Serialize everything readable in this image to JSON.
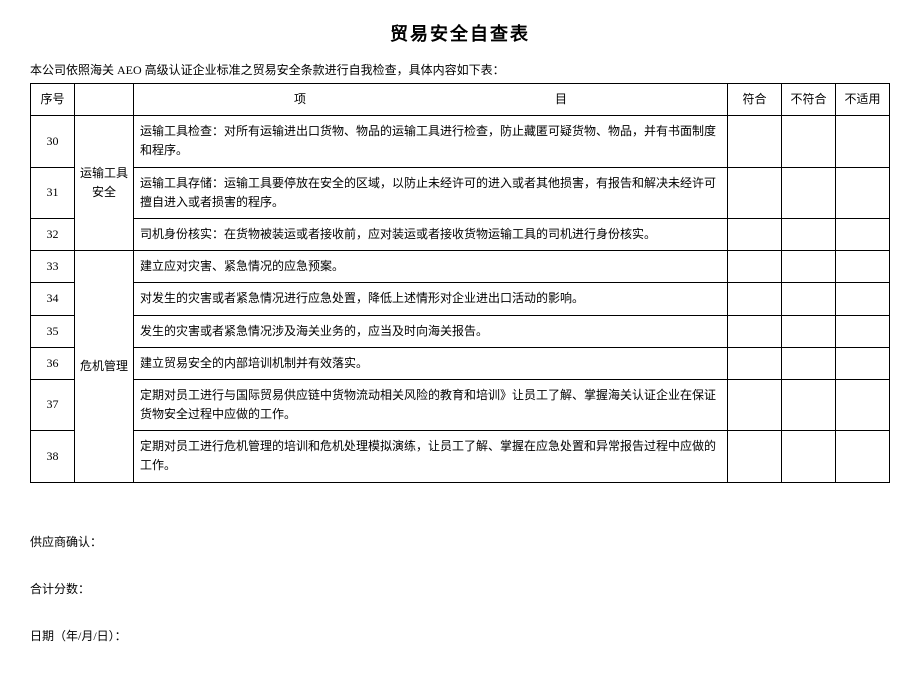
{
  "title": "贸易安全自查表",
  "intro": "本公司依照海关 AEO 高级认证企业标准之贸易安全条款进行自我检查，具体内容如下表：",
  "headers": {
    "seq": "序号",
    "item": "项　　　　　　　　　　　　　　　　目",
    "conform": "符合",
    "nonconform": "不符合",
    "na": "不适用"
  },
  "categories": {
    "transport": "运输工具安全",
    "crisis": "危机管理"
  },
  "rows": {
    "r30": {
      "seq": "30",
      "text": "运输工具检查：对所有运输进出口货物、物品的运输工具进行检查，防止藏匿可疑货物、物品，并有书面制度和程序。"
    },
    "r31": {
      "seq": "31",
      "text": "运输工具存储：运输工具要停放在安全的区域，以防止未经许可的进入或者其他损害，有报告和解决未经许可擅自进入或者损害的程序。"
    },
    "r32": {
      "seq": "32",
      "text": "司机身份核实：在货物被装运或者接收前，应对装运或者接收货物运输工具的司机进行身份核实。"
    },
    "r33": {
      "seq": "33",
      "text": "建立应对灾害、紧急情况的应急预案。"
    },
    "r34": {
      "seq": "34",
      "text": "对发生的灾害或者紧急情况进行应急处置，降低上述情形对企业进出口活动的影响。"
    },
    "r35": {
      "seq": "35",
      "text": "发生的灾害或者紧急情况涉及海关业务的，应当及时向海关报告。"
    },
    "r36": {
      "seq": "36",
      "text": "建立贸易安全的内部培训机制并有效落实。"
    },
    "r37": {
      "seq": "37",
      "text": "定期对员工进行与国际贸易供应链中货物流动相关风险的教育和培训》让员工了解、掌握海关认证企业在保证货物安全过程中应做的工作。"
    },
    "r38": {
      "seq": "38",
      "text": "定期对员工进行危机管理的培训和危机处理模拟演练，让员工了解、掌握在应急处置和异常报告过程中应做的工作。"
    }
  },
  "footer": {
    "confirm": "供应商确认：",
    "score": "合计分数：",
    "date": "日期（年/月/日）："
  }
}
